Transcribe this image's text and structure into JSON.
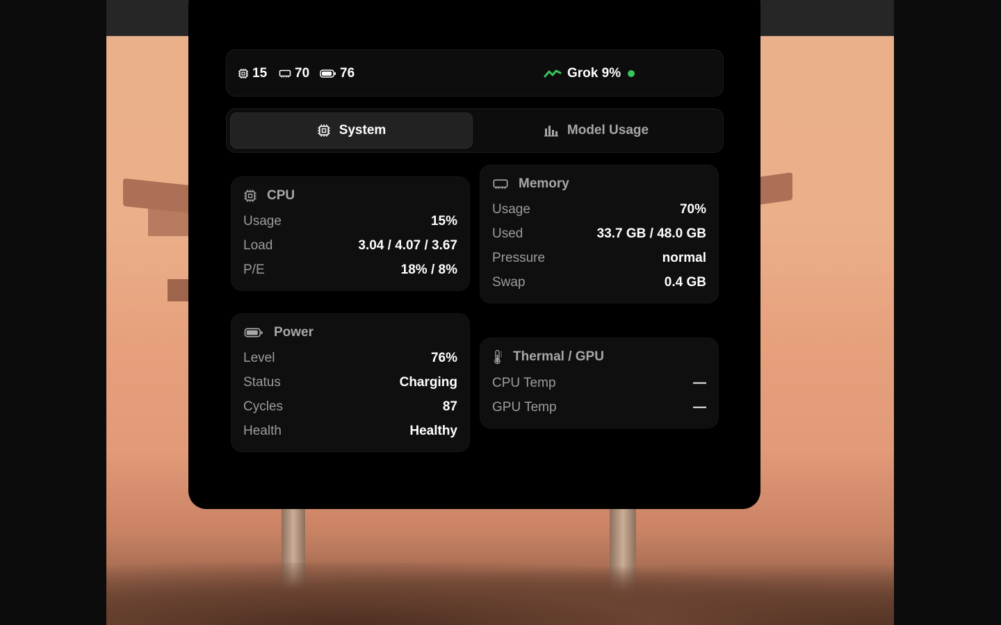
{
  "topbar": {
    "cpu_value": "15",
    "memory_value": "70",
    "battery_value": "76",
    "model_status": "Grok 9%",
    "cpu_icon": "chip-icon",
    "memory_icon": "memory-icon",
    "battery_icon": "battery-icon",
    "model_icon": "activity-icon",
    "status_color": "#37c45a"
  },
  "tabs": [
    {
      "label": "System",
      "icon": "chip-icon",
      "selected": true
    },
    {
      "label": "Model Usage",
      "icon": "bar-chart-icon",
      "selected": false
    }
  ],
  "cpu": {
    "title": "CPU",
    "rows": [
      {
        "label": "Usage",
        "value": "15%"
      },
      {
        "label": "Load",
        "value": "3.04 / 4.07 / 3.67"
      },
      {
        "label": "P/E",
        "value": "18% / 8%"
      }
    ]
  },
  "memory": {
    "title": "Memory",
    "rows": [
      {
        "label": "Usage",
        "value": "70%"
      },
      {
        "label": "Used",
        "value": "33.7 GB / 48.0 GB"
      },
      {
        "label": "Pressure",
        "value": "normal"
      },
      {
        "label": "Swap",
        "value": "0.4 GB"
      }
    ]
  },
  "power": {
    "title": "Power",
    "rows": [
      {
        "label": "Level",
        "value": "76%"
      },
      {
        "label": "Status",
        "value": "Charging"
      },
      {
        "label": "Cycles",
        "value": "87"
      },
      {
        "label": "Health",
        "value": "Healthy"
      }
    ]
  },
  "thermal": {
    "title": "Thermal / GPU",
    "rows": [
      {
        "label": "CPU Temp",
        "value": "—"
      },
      {
        "label": "GPU Temp",
        "value": "—"
      }
    ]
  }
}
